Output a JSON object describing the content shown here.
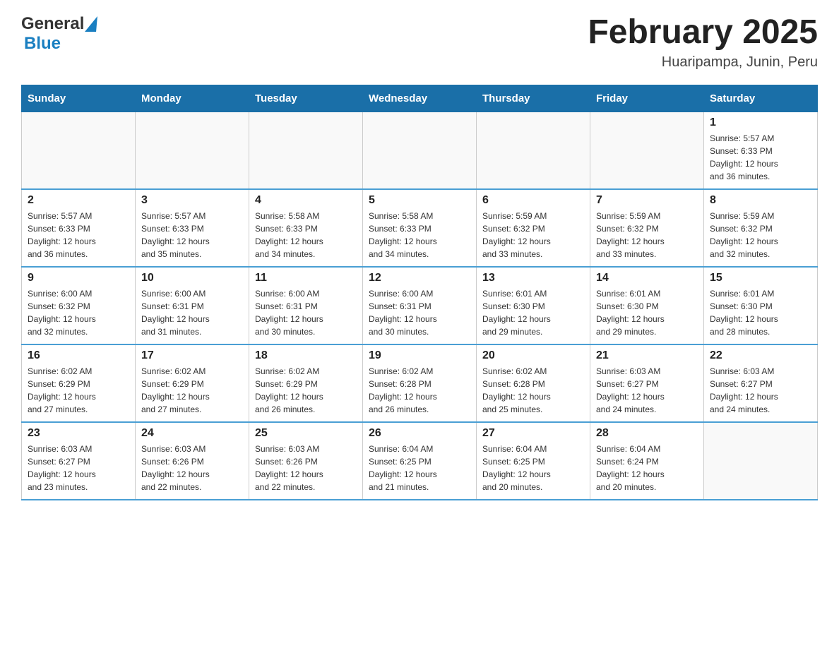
{
  "header": {
    "logo_general": "General",
    "logo_blue": "Blue",
    "month_title": "February 2025",
    "location": "Huaripampa, Junin, Peru"
  },
  "days_of_week": [
    "Sunday",
    "Monday",
    "Tuesday",
    "Wednesday",
    "Thursday",
    "Friday",
    "Saturday"
  ],
  "weeks": [
    [
      {
        "day": "",
        "info": ""
      },
      {
        "day": "",
        "info": ""
      },
      {
        "day": "",
        "info": ""
      },
      {
        "day": "",
        "info": ""
      },
      {
        "day": "",
        "info": ""
      },
      {
        "day": "",
        "info": ""
      },
      {
        "day": "1",
        "info": "Sunrise: 5:57 AM\nSunset: 6:33 PM\nDaylight: 12 hours\nand 36 minutes."
      }
    ],
    [
      {
        "day": "2",
        "info": "Sunrise: 5:57 AM\nSunset: 6:33 PM\nDaylight: 12 hours\nand 36 minutes."
      },
      {
        "day": "3",
        "info": "Sunrise: 5:57 AM\nSunset: 6:33 PM\nDaylight: 12 hours\nand 35 minutes."
      },
      {
        "day": "4",
        "info": "Sunrise: 5:58 AM\nSunset: 6:33 PM\nDaylight: 12 hours\nand 34 minutes."
      },
      {
        "day": "5",
        "info": "Sunrise: 5:58 AM\nSunset: 6:33 PM\nDaylight: 12 hours\nand 34 minutes."
      },
      {
        "day": "6",
        "info": "Sunrise: 5:59 AM\nSunset: 6:32 PM\nDaylight: 12 hours\nand 33 minutes."
      },
      {
        "day": "7",
        "info": "Sunrise: 5:59 AM\nSunset: 6:32 PM\nDaylight: 12 hours\nand 33 minutes."
      },
      {
        "day": "8",
        "info": "Sunrise: 5:59 AM\nSunset: 6:32 PM\nDaylight: 12 hours\nand 32 minutes."
      }
    ],
    [
      {
        "day": "9",
        "info": "Sunrise: 6:00 AM\nSunset: 6:32 PM\nDaylight: 12 hours\nand 32 minutes."
      },
      {
        "day": "10",
        "info": "Sunrise: 6:00 AM\nSunset: 6:31 PM\nDaylight: 12 hours\nand 31 minutes."
      },
      {
        "day": "11",
        "info": "Sunrise: 6:00 AM\nSunset: 6:31 PM\nDaylight: 12 hours\nand 30 minutes."
      },
      {
        "day": "12",
        "info": "Sunrise: 6:00 AM\nSunset: 6:31 PM\nDaylight: 12 hours\nand 30 minutes."
      },
      {
        "day": "13",
        "info": "Sunrise: 6:01 AM\nSunset: 6:30 PM\nDaylight: 12 hours\nand 29 minutes."
      },
      {
        "day": "14",
        "info": "Sunrise: 6:01 AM\nSunset: 6:30 PM\nDaylight: 12 hours\nand 29 minutes."
      },
      {
        "day": "15",
        "info": "Sunrise: 6:01 AM\nSunset: 6:30 PM\nDaylight: 12 hours\nand 28 minutes."
      }
    ],
    [
      {
        "day": "16",
        "info": "Sunrise: 6:02 AM\nSunset: 6:29 PM\nDaylight: 12 hours\nand 27 minutes."
      },
      {
        "day": "17",
        "info": "Sunrise: 6:02 AM\nSunset: 6:29 PM\nDaylight: 12 hours\nand 27 minutes."
      },
      {
        "day": "18",
        "info": "Sunrise: 6:02 AM\nSunset: 6:29 PM\nDaylight: 12 hours\nand 26 minutes."
      },
      {
        "day": "19",
        "info": "Sunrise: 6:02 AM\nSunset: 6:28 PM\nDaylight: 12 hours\nand 26 minutes."
      },
      {
        "day": "20",
        "info": "Sunrise: 6:02 AM\nSunset: 6:28 PM\nDaylight: 12 hours\nand 25 minutes."
      },
      {
        "day": "21",
        "info": "Sunrise: 6:03 AM\nSunset: 6:27 PM\nDaylight: 12 hours\nand 24 minutes."
      },
      {
        "day": "22",
        "info": "Sunrise: 6:03 AM\nSunset: 6:27 PM\nDaylight: 12 hours\nand 24 minutes."
      }
    ],
    [
      {
        "day": "23",
        "info": "Sunrise: 6:03 AM\nSunset: 6:27 PM\nDaylight: 12 hours\nand 23 minutes."
      },
      {
        "day": "24",
        "info": "Sunrise: 6:03 AM\nSunset: 6:26 PM\nDaylight: 12 hours\nand 22 minutes."
      },
      {
        "day": "25",
        "info": "Sunrise: 6:03 AM\nSunset: 6:26 PM\nDaylight: 12 hours\nand 22 minutes."
      },
      {
        "day": "26",
        "info": "Sunrise: 6:04 AM\nSunset: 6:25 PM\nDaylight: 12 hours\nand 21 minutes."
      },
      {
        "day": "27",
        "info": "Sunrise: 6:04 AM\nSunset: 6:25 PM\nDaylight: 12 hours\nand 20 minutes."
      },
      {
        "day": "28",
        "info": "Sunrise: 6:04 AM\nSunset: 6:24 PM\nDaylight: 12 hours\nand 20 minutes."
      },
      {
        "day": "",
        "info": ""
      }
    ]
  ]
}
